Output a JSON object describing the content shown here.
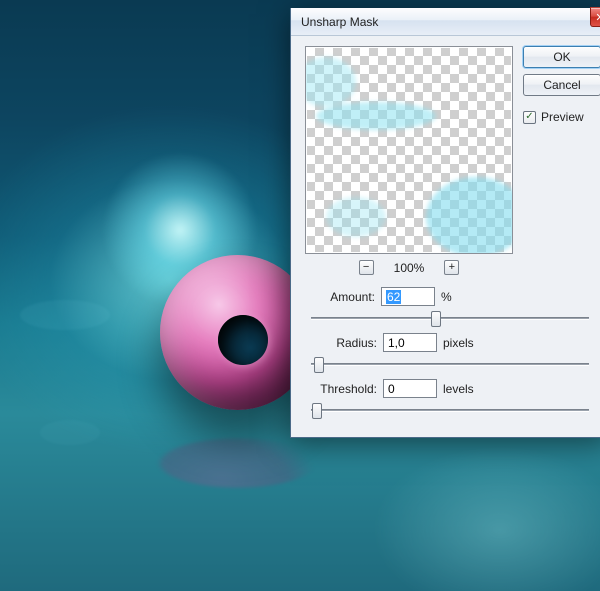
{
  "dialog": {
    "title": "Unsharp Mask",
    "ok_label": "OK",
    "cancel_label": "Cancel",
    "preview_label": "Preview",
    "preview_checked": true,
    "zoom": {
      "minus": "−",
      "pct": "100%",
      "plus": "+"
    },
    "params": {
      "amount": {
        "label": "Amount:",
        "value": "62",
        "unit": "%",
        "slider_pct": 45
      },
      "radius": {
        "label": "Radius:",
        "value": "1,0",
        "unit": "pixels",
        "slider_pct": 3
      },
      "threshold": {
        "label": "Threshold:",
        "value": "0",
        "unit": "levels",
        "slider_pct": 2
      }
    }
  },
  "colors": {
    "accent": "#3399ff",
    "close_red": "#d94b3f",
    "bg_deep": "#0a3a52",
    "torus_pink": "#e77fc0"
  }
}
